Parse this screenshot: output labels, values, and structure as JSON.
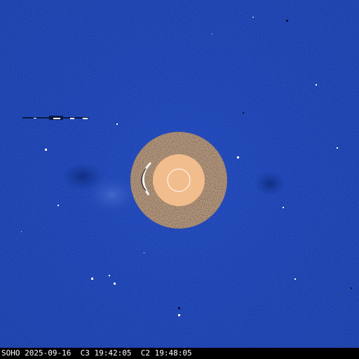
{
  "footer": {
    "observatory": "SOHO",
    "date": "2025-09-16",
    "c3_label": "C3",
    "c3_time": "19:42:05",
    "c2_label": "C2",
    "c2_time": "19:48:05"
  },
  "colors": {
    "sky": "#1b40b0",
    "sun_disk": "#f2bd8c",
    "occulter_ring": "#ffffff",
    "footer_bg": "#000000",
    "footer_text": "#ffffff"
  }
}
